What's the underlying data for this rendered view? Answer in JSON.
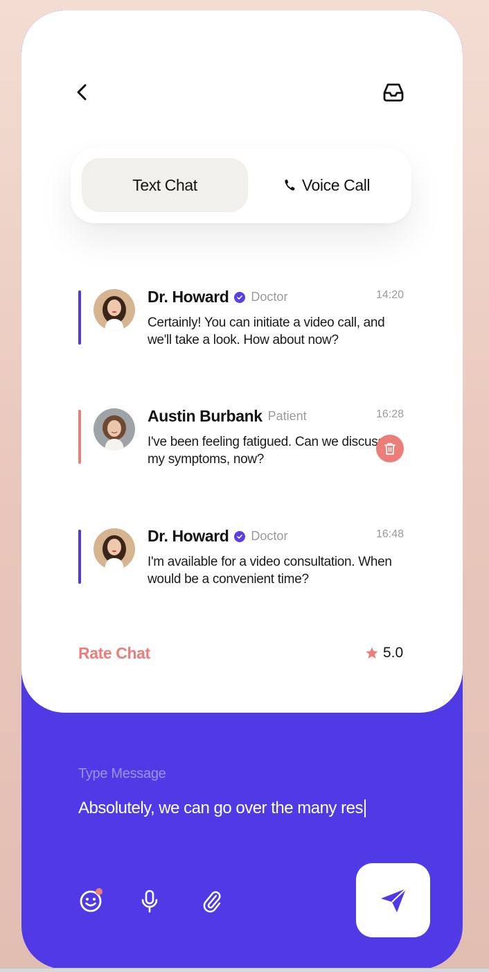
{
  "header": {
    "back_icon": "chevron-left-icon",
    "inbox_icon": "inbox-icon"
  },
  "tabs": [
    {
      "label": "Text Chat",
      "active": true
    },
    {
      "label": "Voice Call",
      "active": false,
      "icon": "phone-icon"
    }
  ],
  "messages": [
    {
      "name": "Dr. Howard",
      "verified": true,
      "role": "Doctor",
      "time": "14:20",
      "text": "Certainly! You can initiate a video call, and we'll take a look. How about now?",
      "bar_color": "#4f3ae6"
    },
    {
      "name": "Austin Burbank",
      "verified": false,
      "role": "Patient",
      "time": "16:28",
      "text": "I've been feeling fatigued. Can we discuss my symptoms, now?",
      "bar_color": "#ec7e79",
      "action_icon": "trash-icon"
    },
    {
      "name": "Dr. Howard",
      "verified": true,
      "role": "Doctor",
      "time": "16:48",
      "text": "I'm available for a video consultation. When would be a convenient time?",
      "bar_color": "#4f3ae6"
    }
  ],
  "rating": {
    "label": "Rate Chat",
    "value": "5.0",
    "icon": "star-icon"
  },
  "composer": {
    "label": "Type Message",
    "value": "Absolutely, we can go over the many res",
    "tools": [
      "smile-icon",
      "microphone-icon",
      "paperclip-icon"
    ],
    "send_icon": "send-icon"
  },
  "colors": {
    "accent": "#4f3ae6",
    "coral": "#ec7e79",
    "background": "#f3ddd3"
  }
}
